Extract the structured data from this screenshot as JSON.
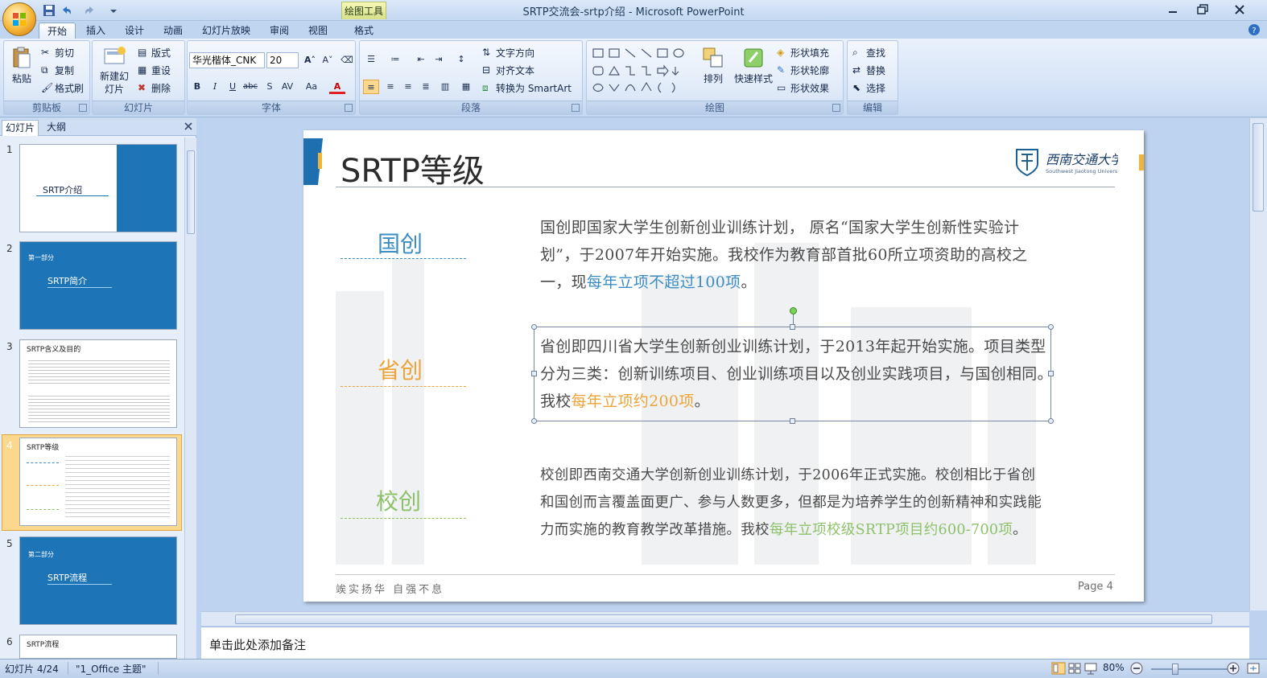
{
  "window": {
    "title": "SRTP交流会-srtp介绍 - Microsoft PowerPoint",
    "contextual_tab_group": "绘图工具"
  },
  "tabs": [
    {
      "label": "开始",
      "active": true
    },
    {
      "label": "插入"
    },
    {
      "label": "设计"
    },
    {
      "label": "动画"
    },
    {
      "label": "幻灯片放映"
    },
    {
      "label": "审阅"
    },
    {
      "label": "视图"
    },
    {
      "label": "格式"
    }
  ],
  "ribbon": {
    "clipboard": {
      "label": "剪贴板",
      "paste": "粘贴",
      "cut": "剪切",
      "copy": "复制",
      "format_painter": "格式刷"
    },
    "slides": {
      "label": "幻灯片",
      "new_slide": "新建幻灯片",
      "layout": "版式",
      "reset": "重设",
      "delete": "删除"
    },
    "font": {
      "label": "字体",
      "font_name": "华光楷体_CNK",
      "font_size": "20"
    },
    "paragraph": {
      "label": "段落",
      "text_direction": "文字方向",
      "align_text": "对齐文本",
      "convert_smartart": "转换为 SmartArt"
    },
    "drawing": {
      "label": "绘图",
      "arrange": "排列",
      "quick_styles": "快速样式",
      "shape_fill": "形状填充",
      "shape_outline": "形状轮廓",
      "shape_effects": "形状效果"
    },
    "editing": {
      "label": "编辑",
      "find": "查找",
      "replace": "替换",
      "select": "选择"
    }
  },
  "left_panel": {
    "tab_slides": "幻灯片",
    "tab_outline": "大纲",
    "thumbnails": [
      {
        "num": "1",
        "title": "SRTP介绍"
      },
      {
        "num": "2",
        "title": "SRTP简介",
        "section": "第一部分"
      },
      {
        "num": "3",
        "title": "SRTP含义及目的"
      },
      {
        "num": "4",
        "title": "SRTP等级",
        "selected": true
      },
      {
        "num": "5",
        "title": "SRTP流程",
        "section": "第二部分"
      },
      {
        "num": "6",
        "title": "SRTP流程"
      }
    ]
  },
  "slide": {
    "title": "SRTP等级",
    "levels": [
      {
        "label": "国创",
        "color": "#3b8ec3"
      },
      {
        "label": "省创",
        "color": "#eda339"
      },
      {
        "label": "校创",
        "color": "#8cc16a"
      }
    ],
    "para1_a": "国创即国家大学生创新创业训练计划， 原名“国家大学生创新性实验计划”，于2007年开始实施。我校作为教育部首批60所立项资助的高校之一，现",
    "para1_hl": "每年立项不超过100项",
    "para1_end": "。",
    "para2_a": "省创即四川省大学生创新创业训练计划，于2013年起开始实施。项目类型分为三类：创新训练项目、创业训练项目以及创业实践项目，与国创相同。我校",
    "para2_hl": "每年立项约200项",
    "para2_end": "。",
    "para3_a": "校创即西南交通大学创新创业训练计划，于2006年正式实施。校创相比于省创和国创而言覆盖面更广、参与人数更多，但都是为培养学生的创新精神和实践能力而实施的教育教学改革措施。我校",
    "para3_hl": "每年立项校级SRTP项目约600-700项",
    "para3_end": "。",
    "motto": "竢实扬华 自强不息",
    "page": "Page 4"
  },
  "notes_placeholder": "单击此处添加备注",
  "status": {
    "slide_count": "幻灯片 4/24",
    "theme": "\"1_Office 主题\"",
    "zoom": "80%"
  }
}
